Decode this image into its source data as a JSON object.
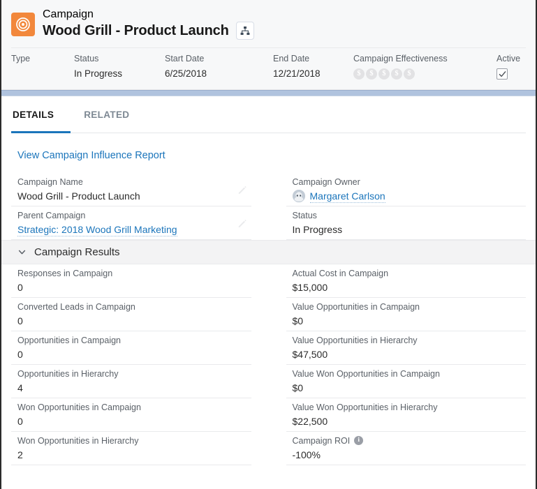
{
  "header": {
    "object_type": "Campaign",
    "record_title": "Wood Grill - Product Launch",
    "record_icon": "campaign-target-icon",
    "hierarchy_button": "view-hierarchy-icon",
    "fields": [
      {
        "label": "Type",
        "value": ""
      },
      {
        "label": "Status",
        "value": "In Progress"
      },
      {
        "label": "Start Date",
        "value": "6/25/2018"
      },
      {
        "label": "End Date",
        "value": "12/21/2018"
      }
    ],
    "effectiveness": {
      "label": "Campaign Effectiveness",
      "coin_symbol": "$",
      "total": 5,
      "filled": 0
    },
    "active": {
      "label": "Active",
      "checked": true
    }
  },
  "tabs": [
    {
      "label": "DETAILS",
      "active": true
    },
    {
      "label": "RELATED",
      "active": false
    }
  ],
  "details": {
    "influence_report_link": "View Campaign Influence Report",
    "top_fields": {
      "left": [
        {
          "label": "Campaign Name",
          "value": "Wood Grill - Product Launch",
          "type": "text",
          "editable": true
        },
        {
          "label": "Parent Campaign",
          "value": "Strategic: 2018 Wood Grill Marketing",
          "type": "link",
          "editable": true
        }
      ],
      "right": [
        {
          "label": "Campaign Owner",
          "value": "Margaret Carlson",
          "type": "link",
          "avatar": true,
          "editable": false
        },
        {
          "label": "Status",
          "value": "In Progress",
          "type": "text",
          "editable": false
        }
      ]
    },
    "section": {
      "title": "Campaign Results",
      "expanded": true,
      "left": [
        {
          "label": "Responses in Campaign",
          "value": "0"
        },
        {
          "label": "Converted Leads in Campaign",
          "value": "0"
        },
        {
          "label": "Opportunities in Campaign",
          "value": "0"
        },
        {
          "label": "Opportunities in Hierarchy",
          "value": "4"
        },
        {
          "label": "Won Opportunities in Campaign",
          "value": "0"
        },
        {
          "label": "Won Opportunities in Hierarchy",
          "value": "2"
        }
      ],
      "right": [
        {
          "label": "Actual Cost in Campaign",
          "value": "$15,000"
        },
        {
          "label": "Value Opportunities in Campaign",
          "value": "$0"
        },
        {
          "label": "Value Opportunities in Hierarchy",
          "value": "$47,500"
        },
        {
          "label": "Value Won Opportunities in Campaign",
          "value": "$0"
        },
        {
          "label": "Value Won Opportunities in Hierarchy",
          "value": "$22,500"
        },
        {
          "label": "Campaign ROI",
          "value": "-100%",
          "info": true
        }
      ]
    }
  },
  "colors": {
    "brand_blue": "#1b75bb",
    "campaign_orange": "#f2883c",
    "band_blue": "#b0c3de",
    "label_gray": "#5a6067",
    "value_dark": "#2b2b2b",
    "section_bg": "#f3f3f4",
    "highlights_bg": "#f7f8f9"
  }
}
